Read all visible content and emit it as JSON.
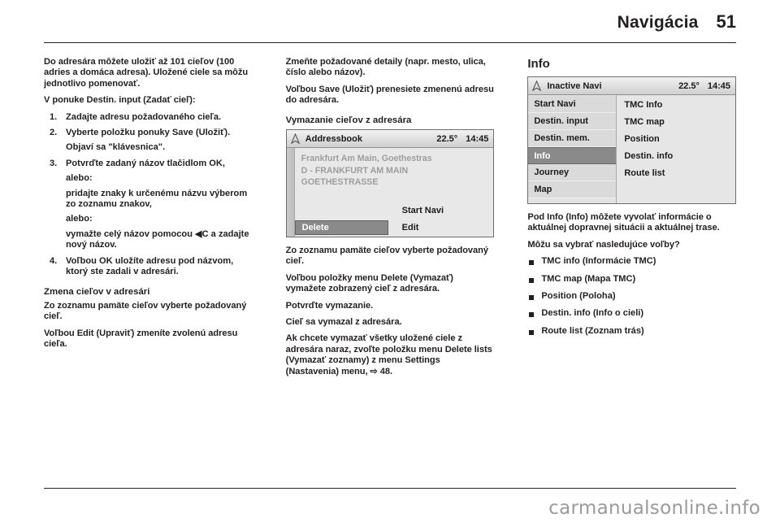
{
  "header": {
    "title": "Navigácia",
    "page_number": "51"
  },
  "footer": {
    "watermark": "carmanualsonline.info"
  },
  "left_column": {
    "intro_p1": "Do adresára môžete uložiť až 101 cieľov (100 adries a domáca adresa). Uložené ciele sa môžu jednotlivo pomenovať.",
    "intro_p2": "V ponuke Destin. input (Zadať cieľ):",
    "steps": [
      {
        "num": "1.",
        "text": "Zadajte adresu požadovaného cieľa."
      },
      {
        "num": "2.",
        "text": "Vyberte položku ponuky Save (Uložiť).",
        "sub": "Objaví sa \"klávesnica\"."
      },
      {
        "num": "3.",
        "text": "Potvrďte zadaný názov tlačidlom OK,",
        "sub_a": "alebo:",
        "sub_b": "pridajte znaky k určenému názvu výberom zo zoznamu znakov,",
        "sub_c": "alebo:",
        "sub_d": "vymažte celý názov pomocou ◀C a zadajte nový názov."
      },
      {
        "num": "4.",
        "text": "Voľbou OK uložíte adresu pod názvom, ktorý ste zadali v adresári."
      }
    ],
    "section_heading": "Zmena cieľov v adresári",
    "section_p1": "Zo zoznamu pamäte cieľov vyberte požadovaný cieľ.",
    "section_p2": "Voľbou Edit (Upraviť) zmeníte zvolenú adresu cieľa."
  },
  "middle_column": {
    "p1": "Zmeňte požadované detaily (napr. mesto, ulica, číslo alebo názov).",
    "p2": "Voľbou Save (Uložiť) prenesiete zmenenú adresu do adresára.",
    "heading": "Vymazanie cieľov z adresára",
    "screen": {
      "icon": "navigation-arrow-icon",
      "title": "Addressbook",
      "temperature": "22.5°",
      "time": "14:45",
      "address_lines": [
        "Frankfurt Am Main, Goethestras",
        "D   - FRANKFURT AM MAIN",
        "GOETHESTRASSE"
      ],
      "start_navi_label": "Start Navi",
      "edit_label": "Edit",
      "delete_label": "Delete"
    },
    "p3": "Zo zoznamu pamäte cieľov vyberte požadovaný cieľ.",
    "p4": "Voľbou položky menu Delete (Vymazať) vymažete zobrazený cieľ z adresára.",
    "p5": "Potvrďte vymazanie.",
    "p6": "Cieľ sa vymazal z adresára.",
    "p7": "Ak chcete vymazať všetky uložené ciele z adresára naraz, zvoľte položku menu Delete lists (Vymazať zoznamy) z menu Settings (Nastavenia) menu, ⇨ 48."
  },
  "right_column": {
    "heading": "Info",
    "screen": {
      "icon": "navigation-arrow-icon",
      "title": "Inactive Navi",
      "temperature": "22.5°",
      "time": "14:45",
      "menu_items": [
        {
          "label": "Start Navi",
          "selected": false
        },
        {
          "label": "Destin. input",
          "selected": false
        },
        {
          "label": "Destin. mem.",
          "selected": false
        },
        {
          "label": "Info",
          "selected": true
        },
        {
          "label": "Journey",
          "selected": false
        },
        {
          "label": "Map",
          "selected": false
        }
      ],
      "submenu_items": [
        "TMC Info",
        "TMC map",
        "Position",
        "Destin. info",
        "Route list"
      ]
    },
    "p1": "Pod Info (Info) môžete vyvolať informácie o aktuálnej dopravnej situácii a aktuálnej trase.",
    "p2": "Môžu sa vybrať nasledujúce voľby?",
    "bullets": [
      "TMC info (Informácie TMC)",
      "TMC map (Mapa TMC)",
      "Position (Poloha)",
      "Destin. info (Info o cieli)",
      "Route list (Zoznam trás)"
    ]
  },
  "colors": {
    "text": "#231f20",
    "screen_bg": "#e3e3e3",
    "screen_selection": "#8a8a8a",
    "screen_dim_text": "#9d9d9d",
    "watermark": "#9b9b9b"
  }
}
